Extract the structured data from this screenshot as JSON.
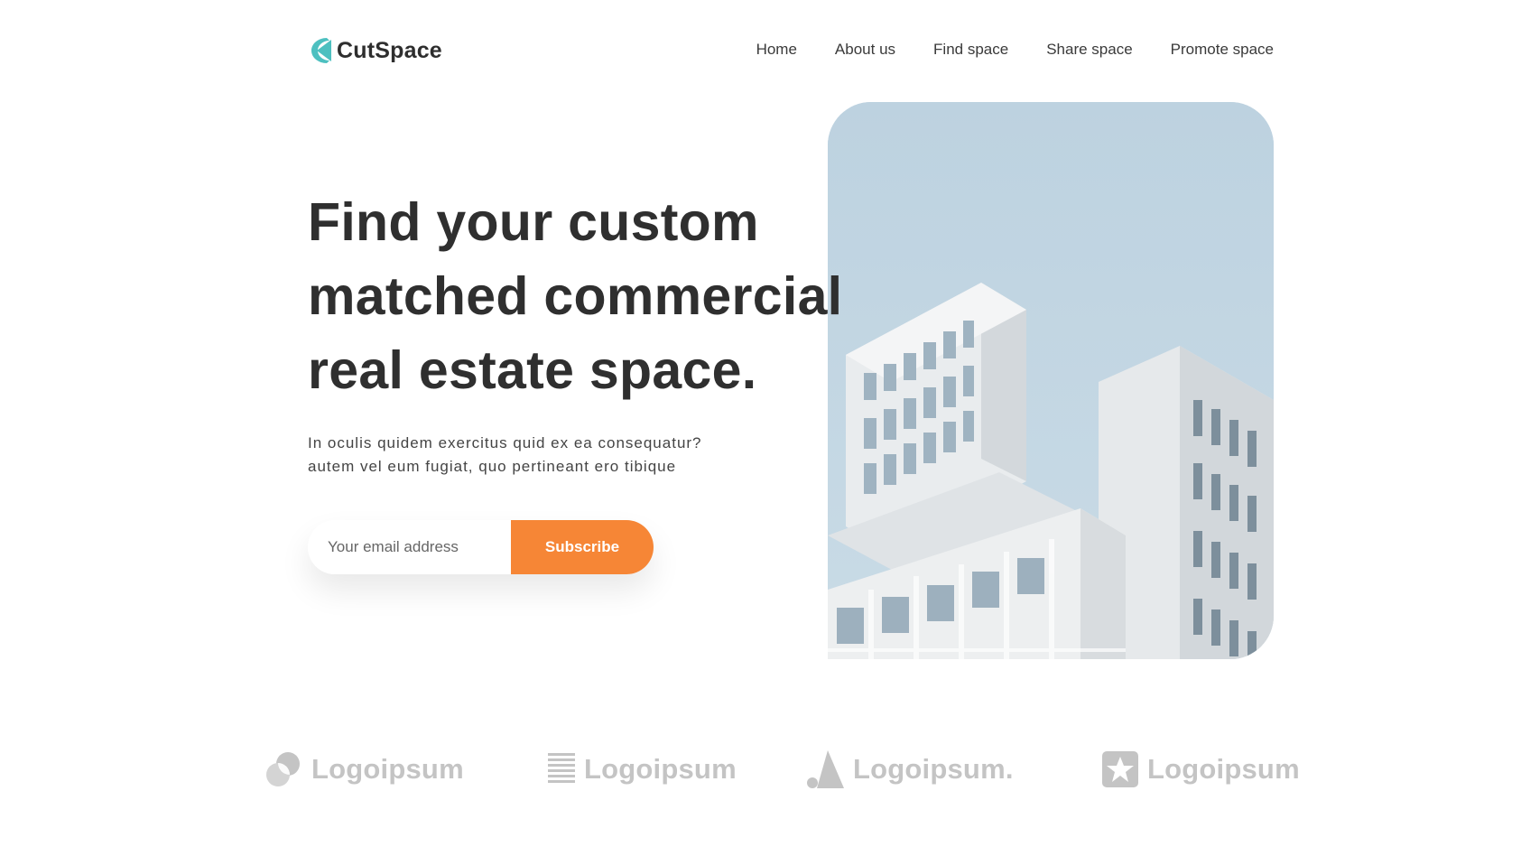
{
  "brand": {
    "name": "CutSpace",
    "accent": "#4dc0c0"
  },
  "nav": {
    "items": [
      {
        "label": "Home"
      },
      {
        "label": "About us"
      },
      {
        "label": "Find space"
      },
      {
        "label": "Share space"
      },
      {
        "label": "Promote space"
      }
    ]
  },
  "hero": {
    "headline": [
      "Find your custom",
      "matched commercial",
      "real estate space."
    ],
    "subtext": [
      "In oculis quidem exercitus quid ex ea consequatur?",
      "autem vel eum fugiat, quo pertineant ero tibique"
    ],
    "email_placeholder": "Your email address",
    "subscribe_label": "Subscribe",
    "button_color": "#f68636",
    "image": "modern-white-building-photo"
  },
  "partners": [
    {
      "name": "Logoipsum",
      "icon": "overlapping-circles-icon"
    },
    {
      "name": "Logoipsum",
      "icon": "striped-square-icon"
    },
    {
      "name": "Logoipsum.",
      "icon": "triangle-dot-icon"
    },
    {
      "name": "Logoipsum",
      "icon": "star-square-icon"
    }
  ]
}
